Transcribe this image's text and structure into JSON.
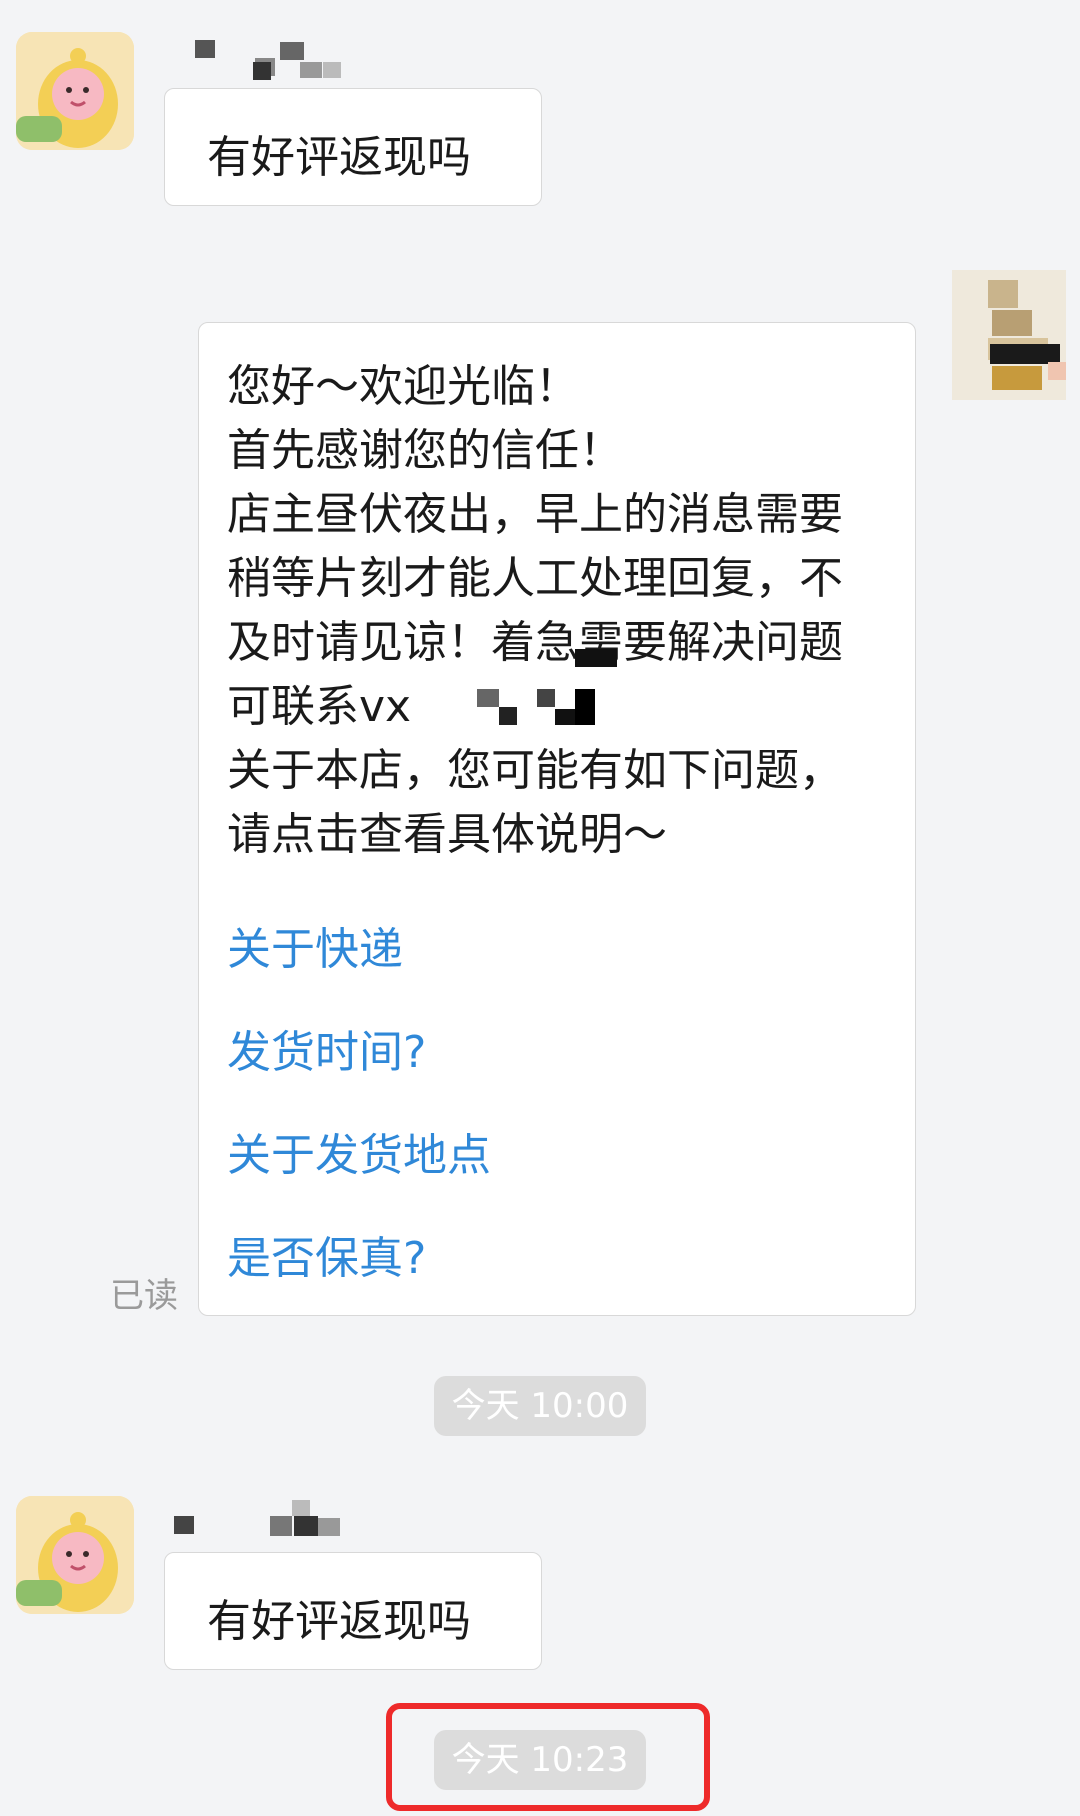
{
  "messages": {
    "first": {
      "text": "有好评返现吗"
    },
    "reply": {
      "lines": [
        "您好～欢迎光临！",
        "首先感谢您的信任！",
        "店主昼伏夜出，早上的消息需要",
        "稍等片刻才能人工处理回复，不",
        "及时请见谅！着急需要解决问题",
        "可联系vx",
        "关于本店，您可能有如下问题，",
        "请点击查看具体说明～"
      ],
      "links": [
        "关于快递",
        "发货时间?",
        "关于发货地点",
        "是否保真?"
      ],
      "read_status": "已读"
    },
    "second": {
      "text": "有好评返现吗"
    }
  },
  "timestamps": {
    "first": "今天 10:00",
    "second": "今天 10:23"
  },
  "colors": {
    "background": "#f3f4f6",
    "link": "#2f88d8",
    "highlight": "#ee2a2a",
    "timestamp_bg": "#dcdcdc"
  },
  "icons": {
    "customer_avatar": "yellow-dino-costume-avatar",
    "shop_avatar": "pixelated-avatar"
  }
}
